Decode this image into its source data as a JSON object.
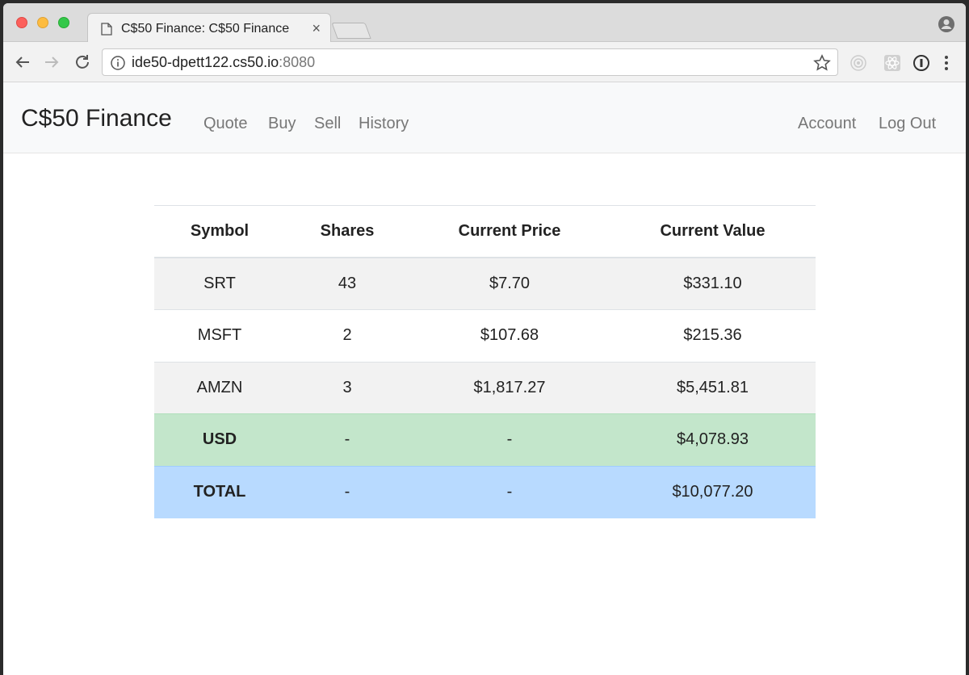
{
  "browser": {
    "tab_title": "C$50 Finance: C$50 Finance",
    "tab_close": "×",
    "url_host": "ide50-dpett122.cs50.io",
    "url_port": ":8080"
  },
  "navbar": {
    "brand": "C$50 Finance",
    "links": [
      "Quote",
      "Buy",
      "Sell",
      "History"
    ],
    "right_links": [
      "Account",
      "Log Out"
    ]
  },
  "table": {
    "headers": [
      "Symbol",
      "Shares",
      "Current Price",
      "Current Value"
    ],
    "rows": [
      [
        "SRT",
        "43",
        "$7.70",
        "$331.10"
      ],
      [
        "MSFT",
        "2",
        "$107.68",
        "$215.36"
      ],
      [
        "AMZN",
        "3",
        "$1,817.27",
        "$5,451.81"
      ]
    ],
    "cash_row": [
      "USD",
      "-",
      "-",
      "$4,078.93"
    ],
    "total_row": [
      "TOTAL",
      "-",
      "-",
      "$10,077.20"
    ]
  },
  "colors": {
    "cash_row_bg": "#c3e6cb",
    "total_row_bg": "#b8daff",
    "navbar_bg": "#f8f9fa"
  }
}
